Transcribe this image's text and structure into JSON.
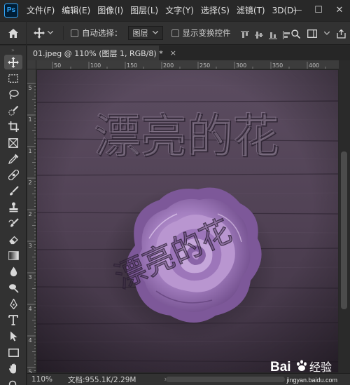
{
  "app": {
    "logo_text": "Ps",
    "brand_color": "#31a8ff"
  },
  "menu": {
    "items": [
      "文件(F)",
      "编辑(E)",
      "图像(I)",
      "图层(L)",
      "文字(Y)",
      "选择(S)",
      "滤镜(T)",
      "3D(D)"
    ]
  },
  "window_controls": {
    "minimize": "—",
    "maximize": "☐",
    "close": "✕"
  },
  "options_bar": {
    "auto_select_label": "自动选择：",
    "auto_select_target": "图层",
    "show_transform_label": "显示变换控件"
  },
  "toolbar": {
    "tools": [
      "move-tool",
      "marquee-tool",
      "lasso-tool",
      "quick-select-tool",
      "crop-tool",
      "frame-tool",
      "eyedropper-tool",
      "healing-brush-tool",
      "brush-tool",
      "clone-stamp-tool",
      "history-brush-tool",
      "eraser-tool",
      "gradient-tool",
      "blur-tool",
      "dodge-tool",
      "pen-tool",
      "type-tool",
      "path-select-tool",
      "rectangle-tool",
      "hand-tool",
      "zoom-tool"
    ]
  },
  "document": {
    "tab_title": "01.jpeg @ 110% (图层 1, RGB/8) *",
    "close": "×"
  },
  "rulers": {
    "h_labels": [
      "50",
      "100",
      "150",
      "200",
      "250",
      "300",
      "350",
      "400"
    ],
    "v_labels": [
      "5",
      "1",
      "1",
      "2",
      "2",
      "3",
      "3",
      "4",
      "4",
      "5"
    ]
  },
  "canvas": {
    "headline": "漂亮的花",
    "overlay_text": "漂亮的花"
  },
  "status": {
    "zoom": "110%",
    "doc_info": "文档:955.1K/2.29M",
    "arrow": "›"
  },
  "watermark": {
    "brand": "Bai",
    "brand2": "经验",
    "url": "jingyan.baidu.com"
  }
}
